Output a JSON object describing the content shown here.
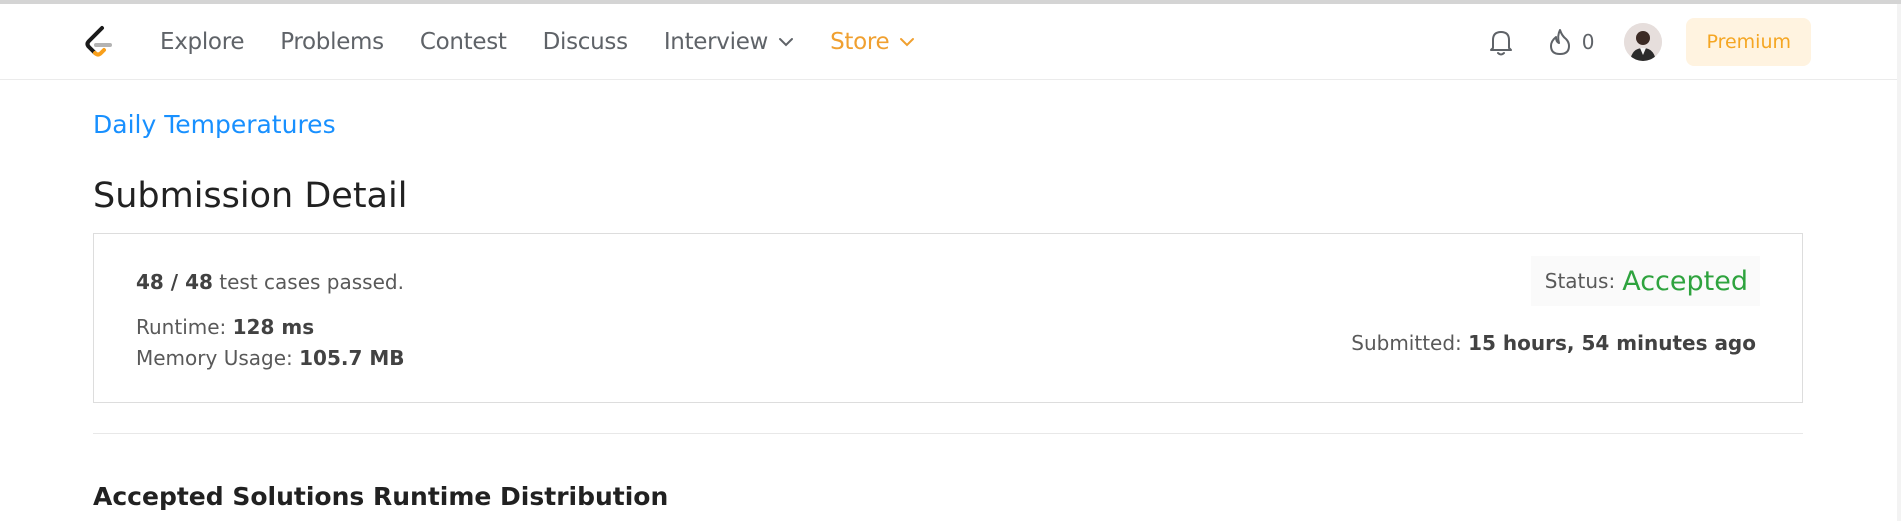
{
  "nav": {
    "links": [
      "Explore",
      "Problems",
      "Contest",
      "Discuss"
    ],
    "interview": "Interview",
    "store": "Store",
    "streak_count": "0",
    "premium": "Premium"
  },
  "problem": {
    "title": "Daily Temperatures"
  },
  "page": {
    "title": "Submission Detail"
  },
  "submission": {
    "tests_passed": "48 / 48",
    "tests_suffix": " test cases passed.",
    "runtime_label": "Runtime: ",
    "runtime_value": "128 ms",
    "memory_label": "Memory Usage: ",
    "memory_value": "105.7 MB",
    "status_label": "Status:",
    "status_value": "Accepted",
    "submitted_label": "Submitted: ",
    "submitted_value": "15 hours, 54 minutes ago"
  },
  "section": {
    "runtime_distribution": "Accepted Solutions Runtime Distribution"
  },
  "colors": {
    "accent_blue": "#1890ff",
    "accepted_green": "#2ea33e",
    "store_orange": "#f0a030",
    "premium_bg": "#fff3e0"
  },
  "icons": {
    "logo": "leetcode-logo-icon",
    "bell": "bell-icon",
    "fire": "fire-icon",
    "chevron": "chevron-down-icon"
  }
}
